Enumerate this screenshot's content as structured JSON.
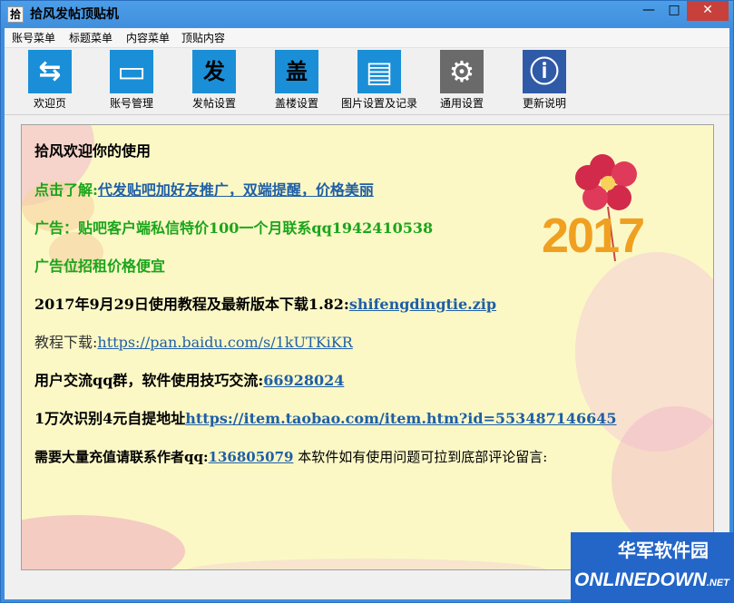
{
  "window": {
    "title": "拾风发帖顶贴机",
    "icon_glyph": "拾",
    "min_glyph": "—",
    "max_glyph": "□",
    "close_glyph": "✕",
    "accent": "#3c8de0"
  },
  "menu": [
    "账号菜单",
    "标题菜单",
    "内容菜单",
    "顶贴内容"
  ],
  "toolbar": [
    {
      "label": "欢迎页",
      "icon": "swap-arrows-icon",
      "glyph": "⇆",
      "color": "#1a8fd8"
    },
    {
      "label": "账号管理",
      "icon": "monitor-icon",
      "glyph": "▭",
      "color": "#1a8fd8"
    },
    {
      "label": "发帖设置",
      "icon": "post-icon",
      "glyph": "发",
      "color": "#1a8fd8"
    },
    {
      "label": "盖楼设置",
      "icon": "reply-icon",
      "glyph": "盖",
      "color": "#1a8fd8"
    },
    {
      "label": "图片设置及记录",
      "icon": "document-icon",
      "glyph": "▤",
      "color": "#1a8fd8"
    },
    {
      "label": "通用设置",
      "icon": "gear-icon",
      "glyph": "⚙",
      "color": "#6a6a6a"
    },
    {
      "label": "更新说明",
      "icon": "info-icon",
      "glyph": "ⓘ",
      "color": "#2f5aa8"
    }
  ],
  "content": {
    "welcome": "拾风欢迎你的使用",
    "promo_prefix": "点击了解:",
    "promo_link": "代发贴吧加好友推广，双端提醒，价格美丽",
    "ad1": "广告：贴吧客户端私信特价100一个月联系qq1942410538",
    "ad2": "广告位招租价格便宜",
    "download_prefix": "2017年9月29日使用教程及最新版本下载1.82:",
    "download_link": "shifengdingtie.zip",
    "tutorial_prefix": "教程下载:",
    "tutorial_link": "https://pan.baidu.com/s/1kUTKiKR",
    "qq_group_prefix": "用户交流qq群，软件使用技巧交流:",
    "qq_group_link": "66928024",
    "captcha_prefix": "1万次识别4元自提地址",
    "captcha_link": "https://item.taobao.com/item.htm?id=553487146645",
    "contact_prefix": "需要大量充值请联系作者qq:",
    "contact_link": "136805079",
    "contact_suffix": "本软件如有使用问题可拉到底部评论留言:",
    "year_art": "2017"
  },
  "watermark": {
    "cn": "华军软件园",
    "en": "ONLINEDOWN",
    "net": ".NET"
  }
}
